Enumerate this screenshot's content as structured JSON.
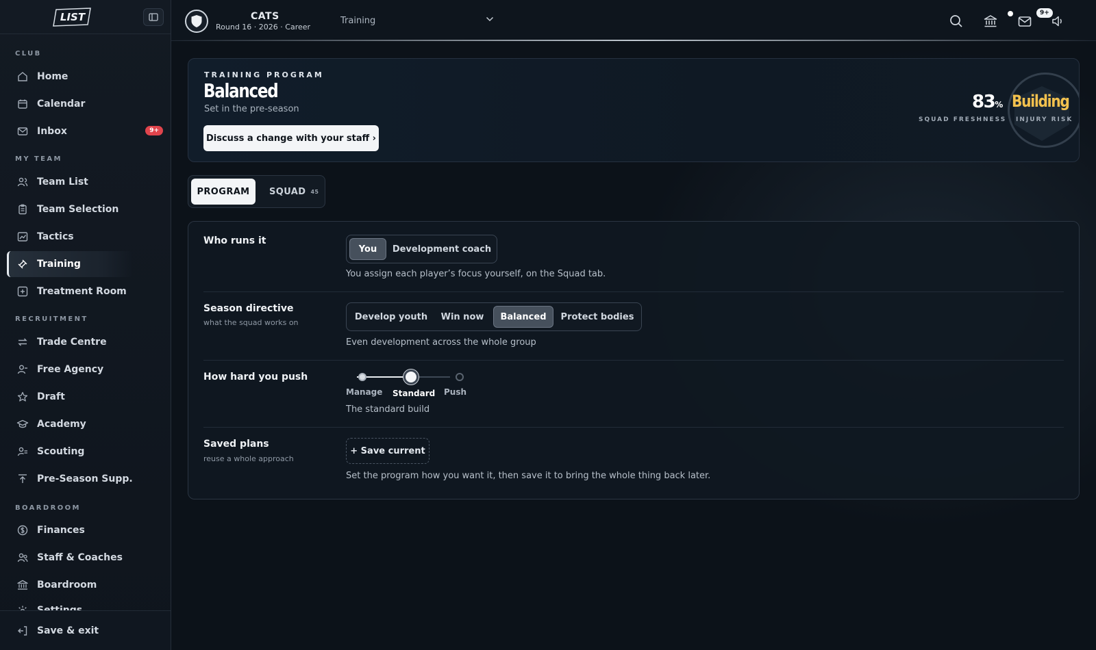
{
  "sidebar": {
    "logo_text": "LIST",
    "sections": {
      "club": "CLUB",
      "my_team": "MY TEAM",
      "recruitment": "RECRUITMENT",
      "boardroom": "BOARDROOM"
    },
    "items": {
      "home": "Home",
      "calendar": "Calendar",
      "inbox": "Inbox",
      "inbox_badge": "9+",
      "team_list": "Team List",
      "team_selection": "Team Selection",
      "tactics": "Tactics",
      "training": "Training",
      "treatment_room": "Treatment Room",
      "trade_centre": "Trade Centre",
      "free_agency": "Free Agency",
      "draft": "Draft",
      "academy": "Academy",
      "scouting": "Scouting",
      "pre_season_supp": "Pre-Season Supp.",
      "finances": "Finances",
      "staff_coaches": "Staff & Coaches",
      "boardroom": "Boardroom",
      "settings": "Settings"
    },
    "save_exit": "Save & exit"
  },
  "topbar": {
    "team_name": "CATS",
    "round_info": "Round 16 · 2026 · Career",
    "breadcrumb": "Training",
    "mail_badge": "9+"
  },
  "hero": {
    "eyebrow": "TRAINING PROGRAM",
    "title": "Balanced",
    "subtitle": "Set in the pre-season",
    "button": "Discuss a change with your staff ›",
    "freshness_value": "83",
    "freshness_unit": "%",
    "freshness_label": "SQUAD FRESHNESS",
    "risk_value": "Building",
    "risk_label": "INJURY RISK"
  },
  "tabs": {
    "program": "PROGRAM",
    "squad": "SQUAD",
    "squad_count": "45"
  },
  "program": {
    "who": {
      "title": "Who runs it",
      "options": [
        "You",
        "Development coach"
      ],
      "selected": "You",
      "help": "You assign each player’s focus yourself, on the Squad tab."
    },
    "directive": {
      "title": "Season directive",
      "sub": "what the squad works on",
      "options": [
        "Develop youth",
        "Win now",
        "Balanced",
        "Protect bodies"
      ],
      "selected": "Balanced",
      "help": "Even development across the whole group"
    },
    "push": {
      "title": "How hard you push",
      "levels": [
        "Manage",
        "Standard",
        "Push"
      ],
      "selected": "Standard",
      "help": "The standard build"
    },
    "saved": {
      "title": "Saved plans",
      "sub": "reuse a whole approach",
      "button": "+ Save current",
      "help": "Set the program how you want it, then save it to bring the whole thing back later."
    }
  },
  "colors": {
    "accent_gold": "#f2c14e",
    "badge_red": "#e0444c"
  }
}
